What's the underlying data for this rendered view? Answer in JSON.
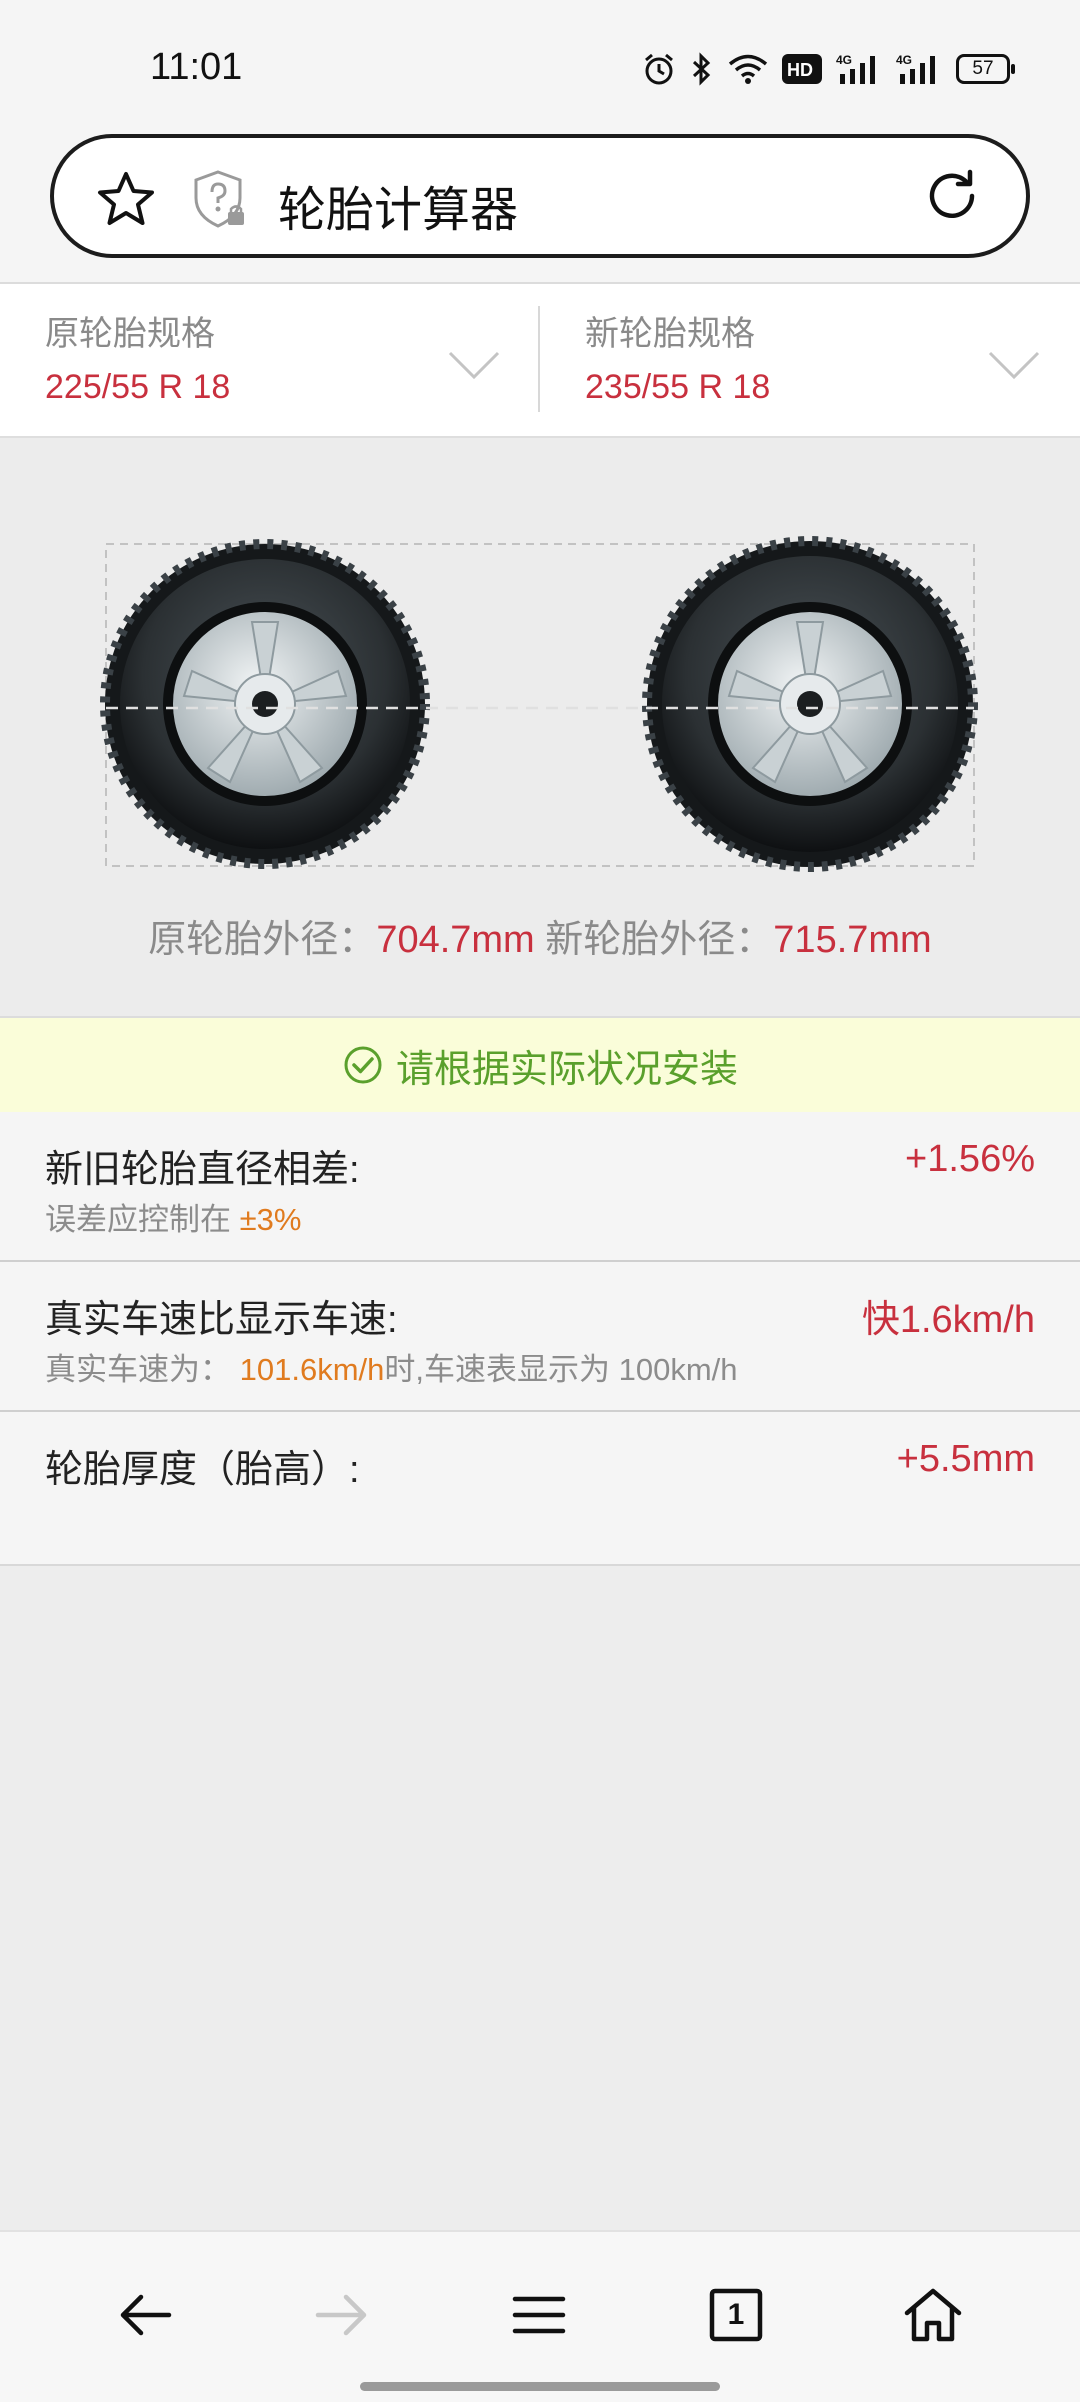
{
  "status_bar": {
    "time": "11:01",
    "battery": "57",
    "icons": [
      "alarm-icon",
      "bluetooth-icon",
      "wifi-icon",
      "hd-icon",
      "signal-4g-icon",
      "signal-4g-icon",
      "battery-icon"
    ]
  },
  "address_bar": {
    "title": "轮胎计算器",
    "icons": [
      "star-icon",
      "shield-question-icon",
      "reload-icon"
    ]
  },
  "selectors": {
    "original": {
      "label": "原轮胎规格",
      "value": "225/55 R 18"
    },
    "new": {
      "label": "新轮胎规格",
      "value": "235/55 R 18"
    }
  },
  "diameters": {
    "original_label": "原轮胎外径：",
    "original_value": "704.7mm",
    "new_label": "新轮胎外径：",
    "new_value": "715.7mm"
  },
  "notice": {
    "text": "请根据实际状况安装"
  },
  "results": {
    "diameter_diff": {
      "title": "新旧轮胎直径相差:",
      "value": "+1.56%",
      "sub_prefix": "误差应控制在",
      "sub_highlight": "±3%"
    },
    "speed": {
      "title": "真实车速比显示车速:",
      "value": "快1.6km/h",
      "sub_prefix": "真实车速为：",
      "sub_highlight": "101.6km/h",
      "sub_suffix": "时,车速表显示为 100km/h"
    },
    "thickness": {
      "title": "轮胎厚度（胎高）:",
      "value": "+5.5mm"
    }
  },
  "colors": {
    "accent_red": "#c8303e",
    "highlight_orange": "#e07b1f",
    "notice_green": "#5aa02c",
    "notice_bg": "#fafdd9"
  },
  "bottom_nav": {
    "tab_count": "1",
    "icons": [
      "back-arrow-icon",
      "forward-arrow-icon",
      "menu-icon",
      "tabs-icon",
      "home-icon"
    ]
  }
}
